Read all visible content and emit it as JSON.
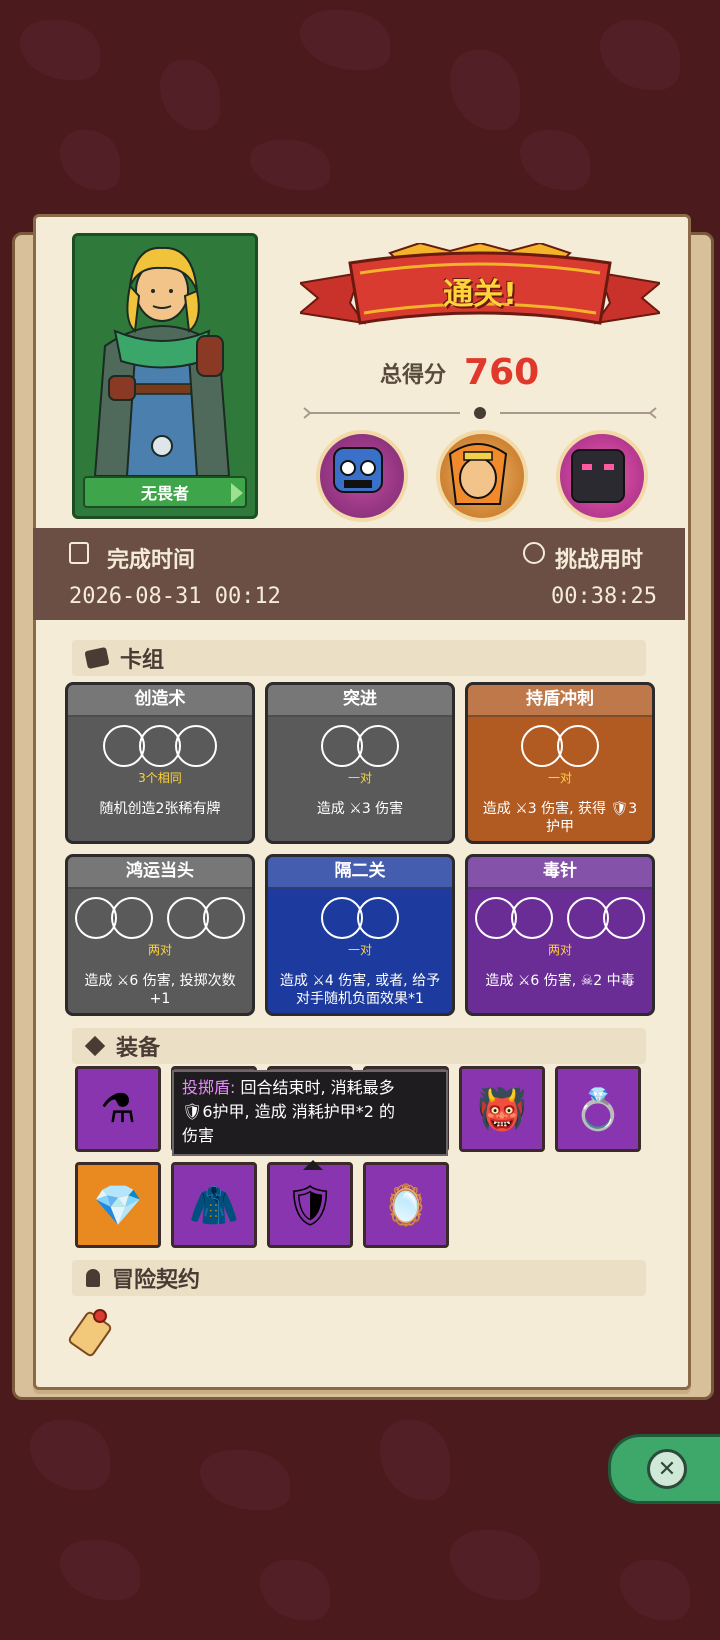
{
  "result": {
    "banner": "通关!",
    "score_label": "总得分",
    "score": "760"
  },
  "hero": {
    "name": "无畏者"
  },
  "time": {
    "finish_label": "完成时间",
    "finish_value": "2026-08-31 00:12",
    "duration_label": "挑战用时",
    "duration_value": "00:38:25"
  },
  "deck": {
    "title": "卡组",
    "cards": [
      {
        "name": "创造术",
        "cond": "3个相同",
        "desc": "随机创造2张稀有牌",
        "color": "#5a5a5a",
        "circles": 3
      },
      {
        "name": "突进",
        "cond": "一对",
        "desc": "造成 ⚔3 伤害",
        "color": "#5a5a5a",
        "circles": 2
      },
      {
        "name": "持盾冲刺",
        "cond": "一对",
        "desc": "造成 ⚔3 伤害, 获得 🛡3 护甲",
        "color": "#b15b22",
        "circles": 2
      },
      {
        "name": "鸿运当头",
        "cond": "两对",
        "desc": "造成 ⚔6 伤害, 投掷次数 +1",
        "color": "#5a5a5a",
        "circles": 4
      },
      {
        "name": "隔二关",
        "cond": "一对",
        "desc": "造成 ⚔4 伤害, 或者, 给予对手随机负面效果*1",
        "color": "#1d3a9e",
        "circles": 2
      },
      {
        "name": "毒针",
        "cond": "两对",
        "desc": "造成 ⚔6 伤害, ☠2 中毒",
        "color": "#6a2d96",
        "circles": 4
      }
    ]
  },
  "equipment": {
    "title": "装备",
    "items": [
      {
        "icon": "potion-icon",
        "glyph": "⚗",
        "color": "#8a35b0"
      },
      {
        "icon": "blank",
        "glyph": "",
        "color": "#8a35b0"
      },
      {
        "icon": "blank",
        "glyph": "",
        "color": "#8a35b0"
      },
      {
        "icon": "blank",
        "glyph": "",
        "color": "#8a35b0"
      },
      {
        "icon": "demon-mask-icon",
        "glyph": "👹",
        "color": "#8a35b0"
      },
      {
        "icon": "ring-icon",
        "glyph": "💍",
        "color": "#8a35b0"
      },
      {
        "icon": "emerald-icon",
        "glyph": "💎",
        "color": "#e88a1f"
      },
      {
        "icon": "cloth-icon",
        "glyph": "🧥",
        "color": "#8a35b0"
      },
      {
        "icon": "shield-icon",
        "glyph": "🛡",
        "color": "#8a35b0"
      },
      {
        "icon": "mirror-icon",
        "glyph": "🪞",
        "color": "#8a35b0"
      }
    ],
    "tooltip": {
      "name": "投掷盾:",
      "text": " 回合结束时, 消耗最多",
      "text2": "🛡6护甲, 造成 消耗护甲*2 的",
      "text3": "伤害"
    }
  },
  "contract": {
    "title": "冒险契约"
  },
  "close": {
    "icon": "close-icon"
  }
}
